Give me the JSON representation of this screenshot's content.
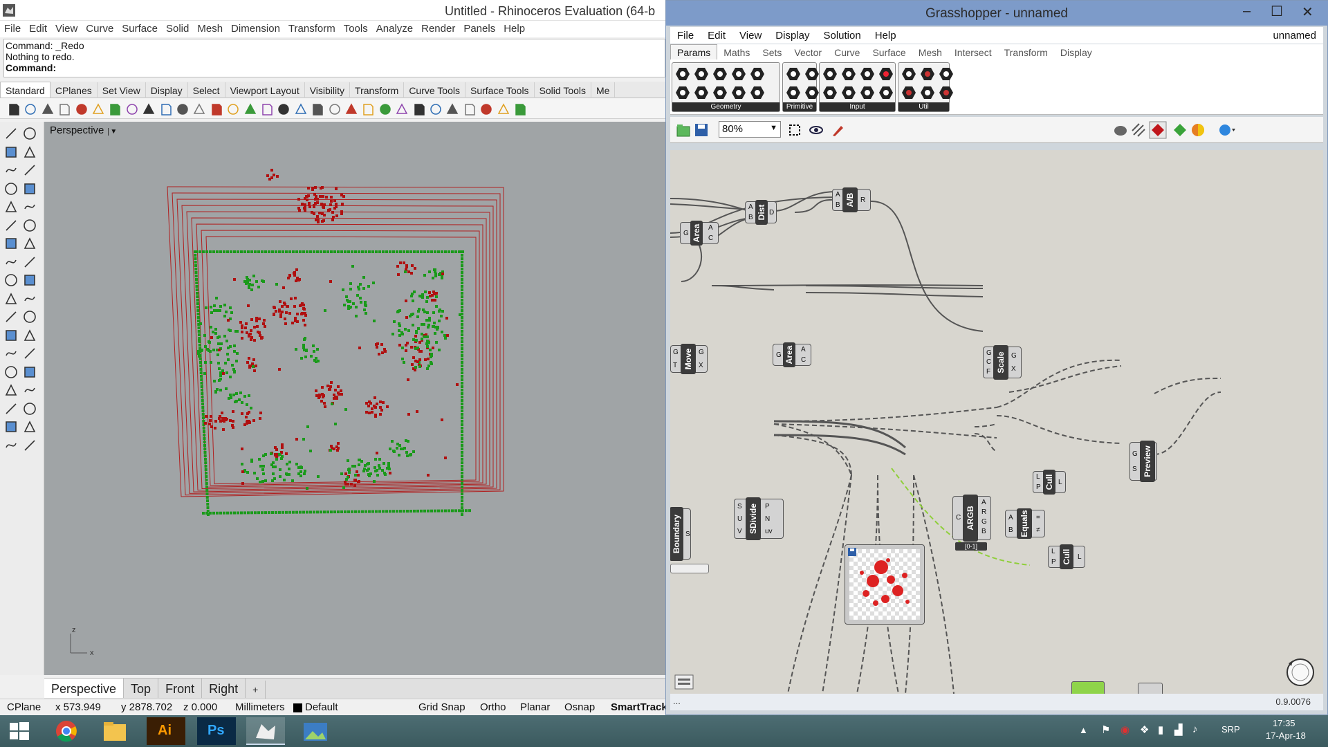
{
  "rhino": {
    "title": "Untitled - Rhinoceros Evaluation (64-b",
    "menu": [
      "File",
      "Edit",
      "View",
      "Curve",
      "Surface",
      "Solid",
      "Mesh",
      "Dimension",
      "Transform",
      "Tools",
      "Analyze",
      "Render",
      "Panels",
      "Help"
    ],
    "command_history": [
      "Command: _Redo",
      "Nothing to redo."
    ],
    "command_prompt": "Command:",
    "toolbar_tabs": [
      "Standard",
      "CPlanes",
      "Set View",
      "Display",
      "Select",
      "Viewport Layout",
      "Visibility",
      "Transform",
      "Curve Tools",
      "Surface Tools",
      "Solid Tools",
      "Me"
    ],
    "active_tab": "Standard",
    "viewport_label": "Perspective",
    "axis_labels": {
      "z": "z",
      "x": "x"
    },
    "viewport_tabs": [
      "Perspective",
      "Top",
      "Front",
      "Right"
    ],
    "add_tab": "+",
    "status": {
      "cplane": "CPlane",
      "x": "x 573.949",
      "y": "y 2878.702",
      "z": "z 0.000",
      "units": "Millimeters",
      "layer": "Default",
      "toggles": [
        "Grid Snap",
        "Ortho",
        "Planar",
        "Osnap",
        "SmartTrack"
      ]
    },
    "colors": {
      "green": "#1a9a1a",
      "red": "#b01010",
      "frame": "#b02020",
      "viewport_bg": "#a0a4a6"
    }
  },
  "grasshopper": {
    "title": "Grasshopper - unnamed",
    "doc_name": "unnamed",
    "menu": [
      "File",
      "Edit",
      "View",
      "Display",
      "Solution",
      "Help"
    ],
    "tabs": [
      "Params",
      "Maths",
      "Sets",
      "Vector",
      "Curve",
      "Surface",
      "Mesh",
      "Intersect",
      "Transform",
      "Display"
    ],
    "active_tab": "Params",
    "ribbon_groups": [
      "Geometry",
      "Primitive",
      "Input",
      "Util"
    ],
    "zoom": "80%",
    "version": "0.9.0076",
    "nodes": {
      "dist": {
        "title": "Dist",
        "inputs": [
          "A",
          "B"
        ],
        "outputs": [
          "D"
        ]
      },
      "div": {
        "title": "A/B",
        "inputs": [
          "A",
          "B"
        ],
        "outputs": [
          "R"
        ]
      },
      "area1": {
        "title": "Area",
        "inputs": [
          "G"
        ],
        "outputs": [
          "A",
          "C"
        ]
      },
      "move": {
        "title": "Move",
        "inputs": [
          "G",
          "T"
        ],
        "outputs": [
          "G",
          "X"
        ]
      },
      "area2": {
        "title": "Area",
        "inputs": [
          "G"
        ],
        "outputs": [
          "A",
          "C"
        ]
      },
      "scale": {
        "title": "Scale",
        "inputs": [
          "G",
          "C",
          "F"
        ],
        "outputs": [
          "G",
          "X"
        ]
      },
      "preview": {
        "title": "Preview",
        "inputs": [
          "G",
          "S"
        ],
        "outputs": []
      },
      "cull1": {
        "title": "Cull",
        "inputs": [
          "L",
          "P"
        ],
        "outputs": [
          "L"
        ]
      },
      "cull2": {
        "title": "Cull",
        "inputs": [
          "L",
          "P"
        ],
        "outputs": [
          "L"
        ]
      },
      "boundary": {
        "title": "Boundary",
        "inputs": [],
        "outputs": [
          "S"
        ]
      },
      "sdivide": {
        "title": "SDivide",
        "inputs": [
          "S",
          "U",
          "V"
        ],
        "outputs": [
          "P",
          "N",
          "uv"
        ]
      },
      "argb": {
        "title": "ARGB",
        "inputs": [
          "C"
        ],
        "outputs": [
          "A",
          "R",
          "G",
          "B"
        ],
        "tag": "[0-1]"
      },
      "equals": {
        "title": "Equals",
        "inputs": [
          "A",
          "B"
        ],
        "outputs": [
          "=",
          "≠"
        ]
      }
    }
  },
  "taskbar": {
    "apps": [
      "windows-start",
      "chrome",
      "file-explorer",
      "illustrator",
      "photoshop",
      "rhino",
      "photos"
    ],
    "ai_label": "Ai",
    "ps_label": "Ps",
    "language": "SRP",
    "time": "17:35",
    "date": "17-Apr-18"
  }
}
